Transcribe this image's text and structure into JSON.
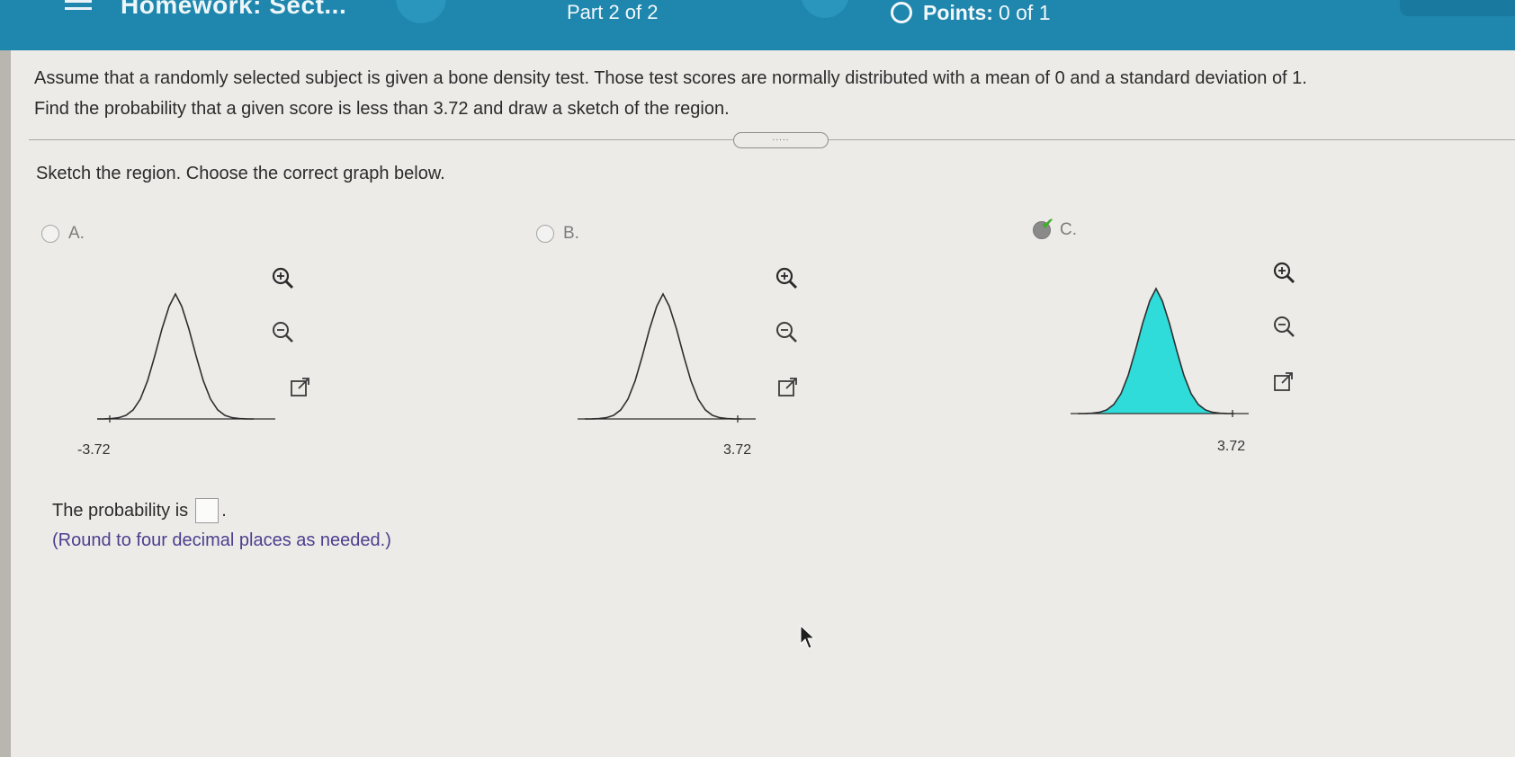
{
  "header": {
    "title": "Homework: Sect...",
    "part": "Part 2 of 2",
    "points_label": "Points:",
    "points_value": "0 of 1"
  },
  "question": {
    "line1": "Assume that a randomly selected subject is given a bone density test. Those test scores are normally distributed with a mean of 0 and a standard deviation of 1.",
    "line2": "Find the probability that a given score is less than 3.72 and draw a sketch of the region."
  },
  "divider_handle": ".....",
  "instruction": "Sketch the region. Choose the correct graph below.",
  "options": [
    {
      "letter": "A.",
      "tick": "-3.72",
      "shaded": false,
      "selected": false
    },
    {
      "letter": "B.",
      "tick": "3.72",
      "shaded": false,
      "selected": false
    },
    {
      "letter": "C.",
      "tick": "3.72",
      "shaded": true,
      "selected": true
    }
  ],
  "icons": [
    "zoom-in-icon",
    "zoom-out-icon",
    "popout-icon"
  ],
  "answer": {
    "prompt": "The probability is",
    "hint": "(Round to four decimal places as needed.)"
  },
  "colors": {
    "header": "#1f86ad",
    "shade": "#2fdcd9",
    "hint": "#4b3f8e",
    "check": "#3eae2c"
  }
}
